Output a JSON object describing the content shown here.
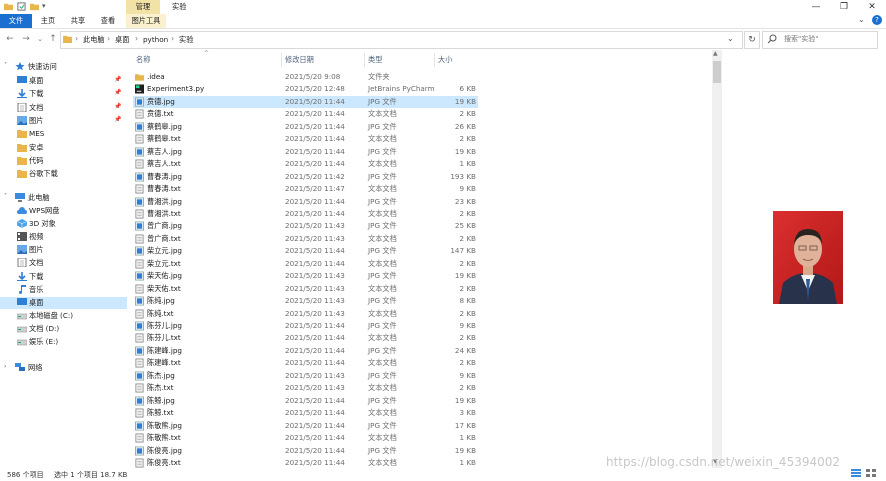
{
  "titlebar": {
    "contextual_tab": "管理",
    "folder_tab": "实验"
  },
  "ribbon": {
    "file": "文件",
    "home": "主页",
    "share": "共享",
    "view": "查看",
    "picture_tools": "图片工具"
  },
  "address": {
    "crumbs": [
      "此电脑",
      "桌面",
      "python",
      "实验"
    ],
    "search_placeholder": "搜索\"实验\""
  },
  "nav": {
    "quick_access": "快速访问",
    "items": [
      {
        "label": "桌面",
        "icon": "desktop-icon",
        "pinned": true
      },
      {
        "label": "下载",
        "icon": "download-icon",
        "pinned": true
      },
      {
        "label": "文档",
        "icon": "documents-icon",
        "pinned": true
      },
      {
        "label": "图片",
        "icon": "pictures-icon",
        "pinned": true
      },
      {
        "label": "MES",
        "icon": "folder-icon",
        "pinned": false
      },
      {
        "label": "安卓",
        "icon": "folder-icon",
        "pinned": false
      },
      {
        "label": "代码",
        "icon": "folder-icon",
        "pinned": false
      },
      {
        "label": "谷歌下载",
        "icon": "folder-icon",
        "pinned": false
      }
    ],
    "this_pc": "此电脑",
    "pc_items": [
      {
        "label": "WPS网盘",
        "icon": "cloud-icon"
      },
      {
        "label": "3D 对象",
        "icon": "3d-objects-icon"
      },
      {
        "label": "视频",
        "icon": "videos-icon"
      },
      {
        "label": "图片",
        "icon": "pictures-icon"
      },
      {
        "label": "文档",
        "icon": "documents-icon"
      },
      {
        "label": "下载",
        "icon": "download-icon"
      },
      {
        "label": "音乐",
        "icon": "music-icon"
      },
      {
        "label": "桌面",
        "icon": "desktop-icon"
      },
      {
        "label": "本地磁盘 (C:)",
        "icon": "drive-icon"
      },
      {
        "label": "文档 (D:)",
        "icon": "drive-icon"
      },
      {
        "label": "娱乐 (E:)",
        "icon": "drive-icon"
      }
    ],
    "network": "网络"
  },
  "columns": {
    "name": "名称",
    "date": "修改日期",
    "type": "类型",
    "size": "大小"
  },
  "files": [
    {
      "name": ".idea",
      "date": "2021/5/20 9:08",
      "type": "文件夹",
      "size": "",
      "icon": "folder"
    },
    {
      "name": "Experiment3.py",
      "date": "2021/5/20 12:48",
      "type": "JetBrains PyCharm",
      "size": "6 KB",
      "icon": "py"
    },
    {
      "name": "贲德.jpg",
      "date": "2021/5/20 11:44",
      "type": "JPG 文件",
      "size": "19 KB",
      "icon": "jpg"
    },
    {
      "name": "贲德.txt",
      "date": "2021/5/20 11:44",
      "type": "文本文档",
      "size": "2 KB",
      "icon": "txt"
    },
    {
      "name": "蔡鹤皋.jpg",
      "date": "2021/5/20 11:44",
      "type": "JPG 文件",
      "size": "26 KB",
      "icon": "jpg"
    },
    {
      "name": "蔡鹤皋.txt",
      "date": "2021/5/20 11:44",
      "type": "文本文档",
      "size": "2 KB",
      "icon": "txt"
    },
    {
      "name": "蔡吉人.jpg",
      "date": "2021/5/20 11:44",
      "type": "JPG 文件",
      "size": "19 KB",
      "icon": "jpg"
    },
    {
      "name": "蔡吉人.txt",
      "date": "2021/5/20 11:44",
      "type": "文本文档",
      "size": "1 KB",
      "icon": "txt"
    },
    {
      "name": "曹春涛.jpg",
      "date": "2021/5/20 11:42",
      "type": "JPG 文件",
      "size": "193 KB",
      "icon": "jpg"
    },
    {
      "name": "曹春涛.txt",
      "date": "2021/5/20 11:47",
      "type": "文本文档",
      "size": "9 KB",
      "icon": "txt"
    },
    {
      "name": "曹湘洪.jpg",
      "date": "2021/5/20 11:44",
      "type": "JPG 文件",
      "size": "23 KB",
      "icon": "jpg"
    },
    {
      "name": "曹湘洪.txt",
      "date": "2021/5/20 11:44",
      "type": "文本文档",
      "size": "2 KB",
      "icon": "txt"
    },
    {
      "name": "曾广商.jpg",
      "date": "2021/5/20 11:43",
      "type": "JPG 文件",
      "size": "25 KB",
      "icon": "jpg"
    },
    {
      "name": "曾广商.txt",
      "date": "2021/5/20 11:43",
      "type": "文本文档",
      "size": "2 KB",
      "icon": "txt"
    },
    {
      "name": "柴立元.jpg",
      "date": "2021/5/20 11:44",
      "type": "JPG 文件",
      "size": "147 KB",
      "icon": "jpg"
    },
    {
      "name": "柴立元.txt",
      "date": "2021/5/20 11:44",
      "type": "文本文档",
      "size": "2 KB",
      "icon": "txt"
    },
    {
      "name": "柴天佑.jpg",
      "date": "2021/5/20 11:43",
      "type": "JPG 文件",
      "size": "19 KB",
      "icon": "jpg"
    },
    {
      "name": "柴天佑.txt",
      "date": "2021/5/20 11:43",
      "type": "文本文档",
      "size": "2 KB",
      "icon": "txt"
    },
    {
      "name": "陈纯.jpg",
      "date": "2021/5/20 11:43",
      "type": "JPG 文件",
      "size": "8 KB",
      "icon": "jpg"
    },
    {
      "name": "陈纯.txt",
      "date": "2021/5/20 11:43",
      "type": "文本文档",
      "size": "2 KB",
      "icon": "txt"
    },
    {
      "name": "陈芬儿.jpg",
      "date": "2021/5/20 11:44",
      "type": "JPG 文件",
      "size": "9 KB",
      "icon": "jpg"
    },
    {
      "name": "陈芬儿.txt",
      "date": "2021/5/20 11:44",
      "type": "文本文档",
      "size": "2 KB",
      "icon": "txt"
    },
    {
      "name": "陈建峰.jpg",
      "date": "2021/5/20 11:44",
      "type": "JPG 文件",
      "size": "24 KB",
      "icon": "jpg"
    },
    {
      "name": "陈建峰.txt",
      "date": "2021/5/20 11:44",
      "type": "文本文档",
      "size": "2 KB",
      "icon": "txt"
    },
    {
      "name": "陈杰.jpg",
      "date": "2021/5/20 11:43",
      "type": "JPG 文件",
      "size": "9 KB",
      "icon": "jpg"
    },
    {
      "name": "陈杰.txt",
      "date": "2021/5/20 11:43",
      "type": "文本文档",
      "size": "2 KB",
      "icon": "txt"
    },
    {
      "name": "陈鲸.jpg",
      "date": "2021/5/20 11:44",
      "type": "JPG 文件",
      "size": "19 KB",
      "icon": "jpg"
    },
    {
      "name": "陈鲸.txt",
      "date": "2021/5/20 11:44",
      "type": "文本文档",
      "size": "3 KB",
      "icon": "txt"
    },
    {
      "name": "陈敬熊.jpg",
      "date": "2021/5/20 11:44",
      "type": "JPG 文件",
      "size": "17 KB",
      "icon": "jpg"
    },
    {
      "name": "陈敬熊.txt",
      "date": "2021/5/20 11:44",
      "type": "文本文档",
      "size": "1 KB",
      "icon": "txt"
    },
    {
      "name": "陈俊亮.jpg",
      "date": "2021/5/20 11:44",
      "type": "JPG 文件",
      "size": "19 KB",
      "icon": "jpg"
    },
    {
      "name": "陈俊亮.txt",
      "date": "2021/5/20 11:44",
      "type": "文本文档",
      "size": "1 KB",
      "icon": "txt"
    }
  ],
  "selected_index": 2,
  "status": {
    "count": "586 个项目",
    "selection": "选中 1 个项目  18.7 KB"
  },
  "watermark": "https://blog.csdn.net/weixin_45394002",
  "colors": {
    "accent": "#1a6fd0",
    "selection": "#cce8ff",
    "manage_tab": "#f3e2a6"
  }
}
